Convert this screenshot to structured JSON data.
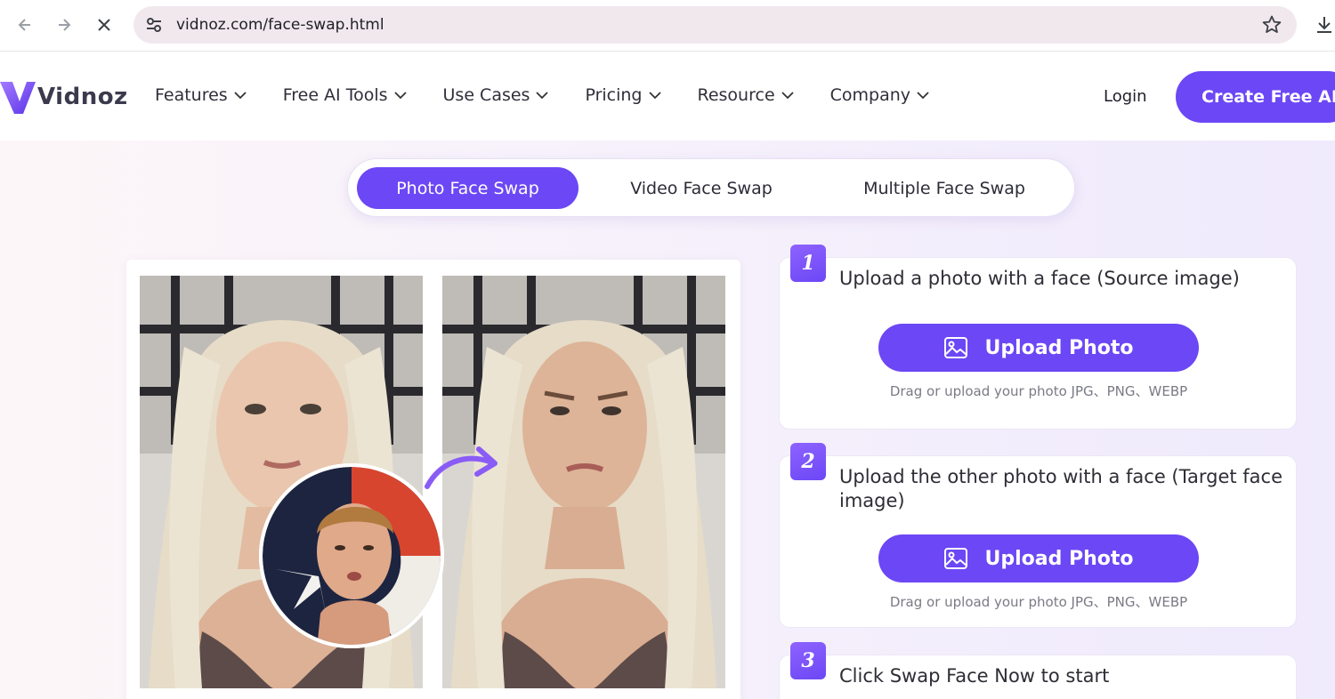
{
  "browser": {
    "url": "vidnoz.com/face-swap.html",
    "icons": [
      "back-arrow-icon",
      "forward-arrow-icon",
      "stop-loading-icon",
      "site-settings-icon",
      "bookmark-star-icon",
      "download-icon"
    ]
  },
  "header": {
    "logo_text": "Vidnoz",
    "menu": [
      {
        "label": "Features"
      },
      {
        "label": "Free AI Tools"
      },
      {
        "label": "Use Cases"
      },
      {
        "label": "Pricing"
      },
      {
        "label": "Resource"
      },
      {
        "label": "Company"
      }
    ],
    "login_label": "Login",
    "cta_label": "Create Free AI Vi"
  },
  "tabs": [
    {
      "label": "Photo Face Swap",
      "active": true
    },
    {
      "label": "Video Face Swap",
      "active": false
    },
    {
      "label": "Multiple Face Swap",
      "active": false
    }
  ],
  "steps": [
    {
      "number": "1",
      "title": "Upload a photo with a face (Source image)",
      "button": "Upload Photo",
      "hint": "Drag or upload your photo JPG、PNG、WEBP"
    },
    {
      "number": "2",
      "title": "Upload the other photo with a face (Target face image)",
      "button": "Upload Photo",
      "hint": "Drag or upload your photo JPG、PNG、WEBP"
    },
    {
      "number": "3",
      "title": "Click Swap Face Now to start"
    }
  ],
  "colors": {
    "accent": "#6c47f5",
    "background": "#f4effb",
    "text": "#2d2d35"
  }
}
